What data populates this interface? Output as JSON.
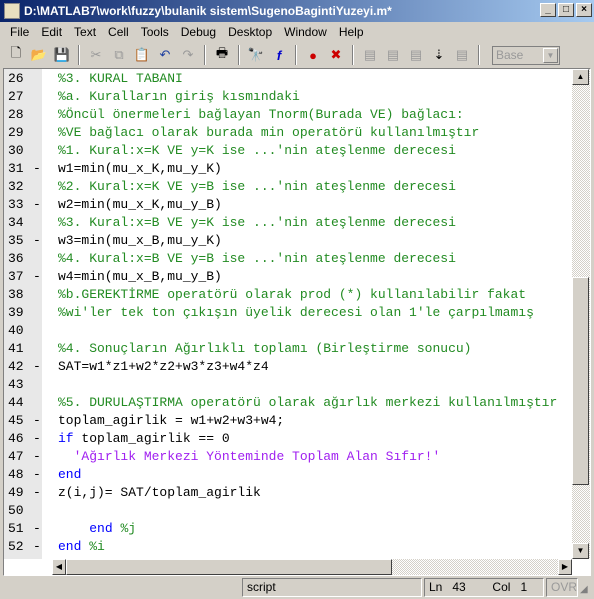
{
  "window": {
    "title": "D:\\MATLAB7\\work\\fuzzy\\bulanik sistem\\SugenoBagintiYuzeyi.m*",
    "minimize": "_",
    "maximize": "□",
    "close": "×"
  },
  "menu": [
    "File",
    "Edit",
    "Text",
    "Cell",
    "Tools",
    "Debug",
    "Desktop",
    "Window",
    "Help"
  ],
  "toolbar": {
    "icons": [
      "new-file-icon",
      "open-folder-icon",
      "save-icon",
      "cut-icon",
      "copy-icon",
      "paste-icon",
      "undo-icon",
      "redo-icon",
      "print-icon",
      "find-icon",
      "function-icon",
      "set-breakpoint-icon",
      "clear-breakpoints-icon",
      "step-icon",
      "step-in-icon",
      "step-out-icon",
      "continue-icon",
      "exit-debug-icon"
    ],
    "stack_value": "Base"
  },
  "editor": {
    "lines": [
      {
        "n": "26",
        "x": false,
        "seg": [
          [
            "cm",
            "%3. KURAL TABANI"
          ]
        ]
      },
      {
        "n": "27",
        "x": false,
        "seg": [
          [
            "cm",
            "%a. Kuralların giriş kısmındaki"
          ]
        ]
      },
      {
        "n": "28",
        "x": false,
        "seg": [
          [
            "cm",
            "%Öncül önermeleri bağlayan Tnorm(Burada VE) bağlacı:"
          ]
        ]
      },
      {
        "n": "29",
        "x": false,
        "seg": [
          [
            "cm",
            "%VE bağlacı olarak burada min operatörü kullanılmıştır"
          ]
        ]
      },
      {
        "n": "30",
        "x": false,
        "seg": [
          [
            "cm",
            "%1. Kural:x=K VE y=K ise ...'nin ateşlenme derecesi"
          ]
        ]
      },
      {
        "n": "31",
        "x": true,
        "seg": [
          [
            "tx",
            "w1=min(mu_x_K,mu_y_K)"
          ]
        ]
      },
      {
        "n": "32",
        "x": false,
        "seg": [
          [
            "cm",
            "%2. Kural:x=K VE y=B ise ...'nin ateşlenme derecesi"
          ]
        ]
      },
      {
        "n": "33",
        "x": true,
        "seg": [
          [
            "tx",
            "w2=min(mu_x_K,mu_y_B)"
          ]
        ]
      },
      {
        "n": "34",
        "x": false,
        "seg": [
          [
            "cm",
            "%3. Kural:x=B VE y=K ise ...'nin ateşlenme derecesi"
          ]
        ]
      },
      {
        "n": "35",
        "x": true,
        "seg": [
          [
            "tx",
            "w3=min(mu_x_B,mu_y_K)"
          ]
        ]
      },
      {
        "n": "36",
        "x": false,
        "seg": [
          [
            "cm",
            "%4. Kural:x=B VE y=B ise ...'nin ateşlenme derecesi"
          ]
        ]
      },
      {
        "n": "37",
        "x": true,
        "seg": [
          [
            "tx",
            "w4=min(mu_x_B,mu_y_B)"
          ]
        ]
      },
      {
        "n": "38",
        "x": false,
        "seg": [
          [
            "cm",
            "%b.GEREKTİRME operatörü olarak prod (*) kullanılabilir fakat"
          ]
        ]
      },
      {
        "n": "39",
        "x": false,
        "seg": [
          [
            "cm",
            "%wi'ler tek ton çıkışın üyelik derecesi olan 1'le çarpılmamış"
          ]
        ]
      },
      {
        "n": "40",
        "x": false,
        "seg": []
      },
      {
        "n": "41",
        "x": false,
        "seg": [
          [
            "cm",
            "%4. Sonuçların Ağırlıklı toplamı (Birleştirme sonucu)"
          ]
        ]
      },
      {
        "n": "42",
        "x": true,
        "seg": [
          [
            "tx",
            "SAT=w1*z1+w2*z2+w3*z3+w4*z4"
          ]
        ]
      },
      {
        "n": "43",
        "x": false,
        "seg": []
      },
      {
        "n": "44",
        "x": false,
        "seg": [
          [
            "cm",
            "%5. DURULAŞTIRMA operatörü olarak ağırlık merkezi kullanılmıştır"
          ]
        ]
      },
      {
        "n": "45",
        "x": true,
        "seg": [
          [
            "tx",
            "toplam_agirlik = w1+w2+w3+w4;"
          ]
        ]
      },
      {
        "n": "46",
        "x": true,
        "seg": [
          [
            "kw",
            "if"
          ],
          [
            "tx",
            " toplam_agirlik == 0"
          ]
        ]
      },
      {
        "n": "47",
        "x": true,
        "seg": [
          [
            "tx",
            "  "
          ],
          [
            "st",
            "'Ağırlık Merkezi Yönteminde Toplam Alan Sıfır!'"
          ]
        ]
      },
      {
        "n": "48",
        "x": true,
        "seg": [
          [
            "kw",
            "end"
          ]
        ]
      },
      {
        "n": "49",
        "x": true,
        "seg": [
          [
            "tx",
            "z(i,j)= SAT/toplam_agirlik"
          ]
        ]
      },
      {
        "n": "50",
        "x": false,
        "seg": []
      },
      {
        "n": "51",
        "x": true,
        "seg": [
          [
            "tx",
            "    "
          ],
          [
            "kw",
            "end"
          ],
          [
            "tx",
            " "
          ],
          [
            "cm",
            "%j"
          ]
        ]
      },
      {
        "n": "52",
        "x": true,
        "seg": [
          [
            "kw",
            "end"
          ],
          [
            "tx",
            " "
          ],
          [
            "cm",
            "%i"
          ]
        ]
      }
    ],
    "breakpoint_marker": "-"
  },
  "status": {
    "mode": "script",
    "ln_label": "Ln",
    "ln": "43",
    "col_label": "Col",
    "col": "1",
    "ovr": "OVR"
  }
}
